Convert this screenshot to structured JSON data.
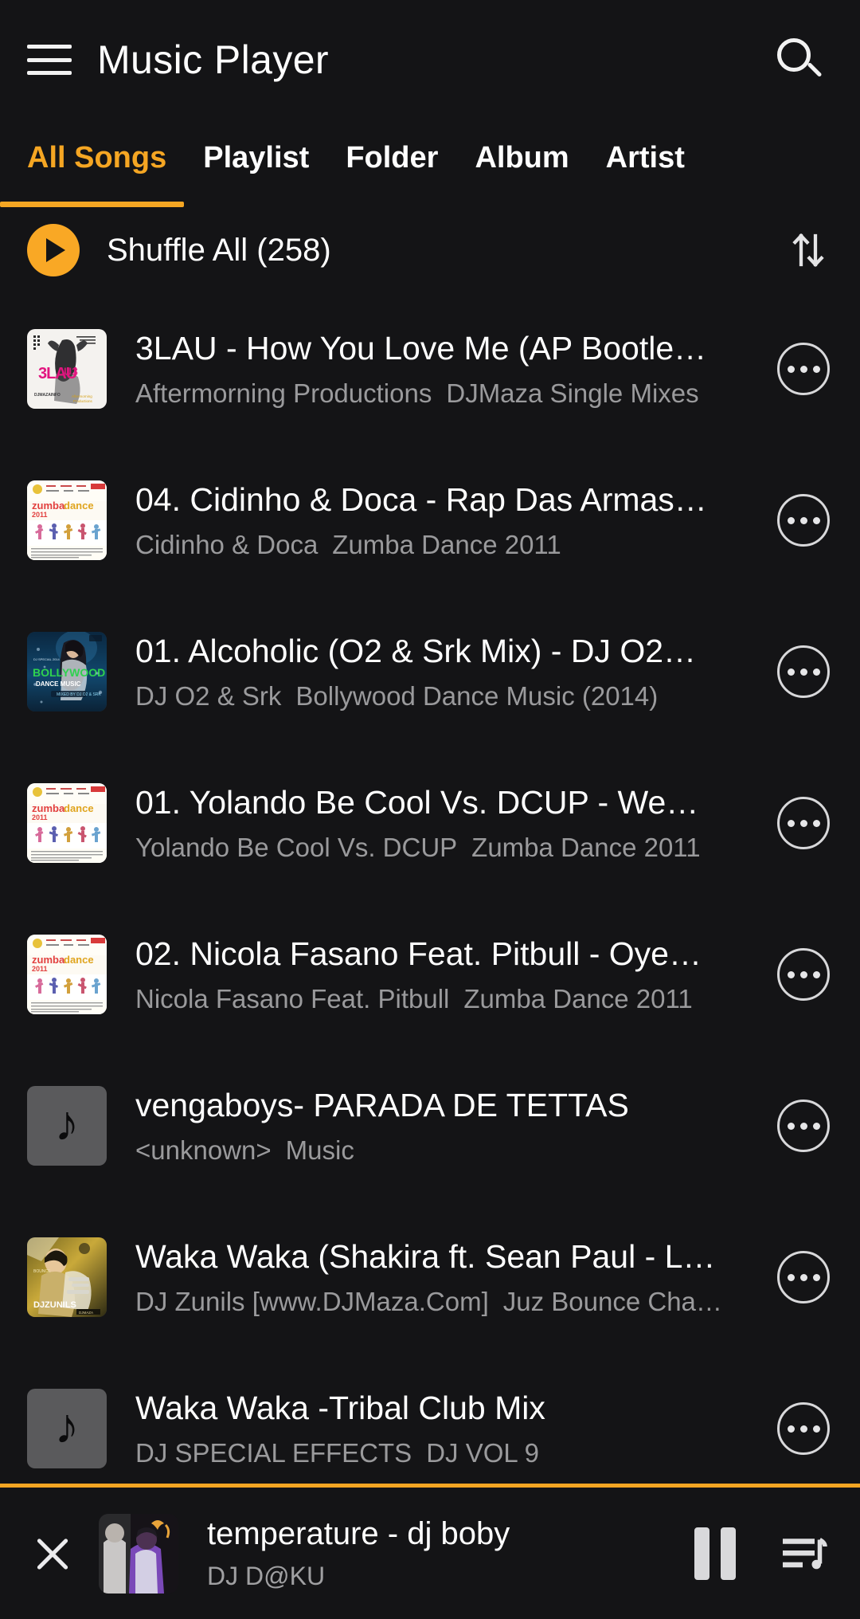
{
  "theme": {
    "background": "#141416",
    "accent": "#f5a623",
    "shuffle_button": "#f9a825",
    "primary_text": "#ffffff",
    "secondary_text": "#9a9a9c"
  },
  "appbar": {
    "menu_icon": "hamburger-menu-icon",
    "title": "Music Player",
    "search_icon": "search-icon"
  },
  "tabs": {
    "active_index": 0,
    "items": [
      {
        "label": "All Songs"
      },
      {
        "label": "Playlist"
      },
      {
        "label": "Folder"
      },
      {
        "label": "Album"
      },
      {
        "label": "Artist"
      }
    ]
  },
  "shuffle": {
    "play_icon": "play-icon",
    "label": "Shuffle All (258)",
    "count": 258,
    "sort_icon": "sort-arrows-icon"
  },
  "songs": [
    {
      "title": "3LAU - How You Love Me (AP Bootle…",
      "artist": "Aftermorning Productions",
      "album": "DJMaza Single Mixes",
      "art": "3lau",
      "more_icon": "more-options-icon"
    },
    {
      "title": "04. Cidinho & Doca - Rap Das Armas…",
      "artist": "Cidinho & Doca",
      "album": "Zumba Dance 2011",
      "art": "zumba",
      "more_icon": "more-options-icon"
    },
    {
      "title": "01. Alcoholic (O2 & Srk Mix) - DJ O2…",
      "artist": "DJ O2 & Srk",
      "album": "Bollywood Dance Music (2014)",
      "art": "bollywood",
      "more_icon": "more-options-icon"
    },
    {
      "title": "01. Yolando Be Cool Vs. DCUP - We…",
      "artist": "Yolando Be Cool Vs. DCUP",
      "album": "Zumba Dance 2011",
      "art": "zumba",
      "more_icon": "more-options-icon"
    },
    {
      "title": "02. Nicola Fasano Feat. Pitbull - Oye…",
      "artist": "Nicola Fasano Feat. Pitbull",
      "album": "Zumba Dance 2011",
      "art": "zumba",
      "more_icon": "more-options-icon"
    },
    {
      "title": "vengaboys- PARADA DE TETTAS",
      "artist": "<unknown>",
      "album": "Music",
      "art": "placeholder",
      "more_icon": "more-options-icon"
    },
    {
      "title": "Waka Waka (Shakira ft. Sean Paul - L…",
      "artist": "DJ Zunils [www.DJMaza.Com]",
      "album": "Juz Bounce Cha…",
      "art": "zunils",
      "more_icon": "more-options-icon"
    },
    {
      "title": "Waka Waka -Tribal Club Mix",
      "artist": "DJ SPECIAL EFFECTS",
      "album": "DJ VOL 9",
      "art": "placeholder",
      "more_icon": "more-options-icon"
    }
  ],
  "now_playing": {
    "close_icon": "close-icon",
    "art": "daku",
    "title": "temperature - dj boby",
    "artist": "DJ D@KU",
    "pause_icon": "pause-icon",
    "queue_icon": "queue-list-icon"
  }
}
